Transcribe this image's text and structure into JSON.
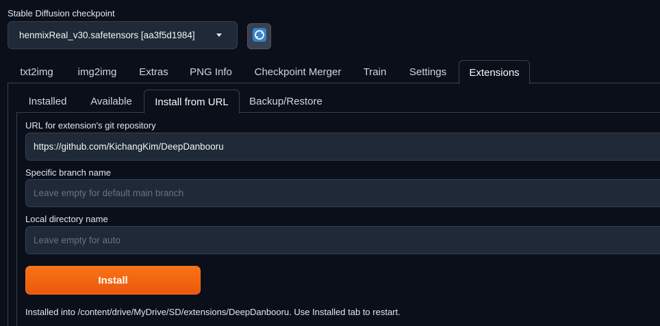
{
  "checkpoint": {
    "label": "Stable Diffusion checkpoint",
    "selected": "henmixReal_v30.safetensors [aa3f5d1984]"
  },
  "main_tabs": [
    {
      "label": "txt2img"
    },
    {
      "label": "img2img"
    },
    {
      "label": "Extras"
    },
    {
      "label": "PNG Info"
    },
    {
      "label": "Checkpoint Merger"
    },
    {
      "label": "Train"
    },
    {
      "label": "Settings"
    },
    {
      "label": "Extensions",
      "active": true
    }
  ],
  "sub_tabs": [
    {
      "label": "Installed"
    },
    {
      "label": "Available"
    },
    {
      "label": "Install from URL",
      "active": true
    },
    {
      "label": "Backup/Restore"
    }
  ],
  "form": {
    "url_label": "URL for extension's git repository",
    "url_value": "https://github.com/KichangKim/DeepDanbooru",
    "branch_label": "Specific branch name",
    "branch_placeholder": "Leave empty for default main branch",
    "dir_label": "Local directory name",
    "dir_placeholder": "Leave empty for auto",
    "install_label": "Install",
    "status": "Installed into /content/drive/MyDrive/SD/extensions/DeepDanbooru. Use Installed tab to restart."
  },
  "colors": {
    "background": "#0b0f19",
    "input_bg": "#1f2937",
    "border": "#374151",
    "accent": "#f97316"
  },
  "icons": {
    "refresh": "refresh-icon",
    "dropdown": "chevron-down-icon"
  }
}
